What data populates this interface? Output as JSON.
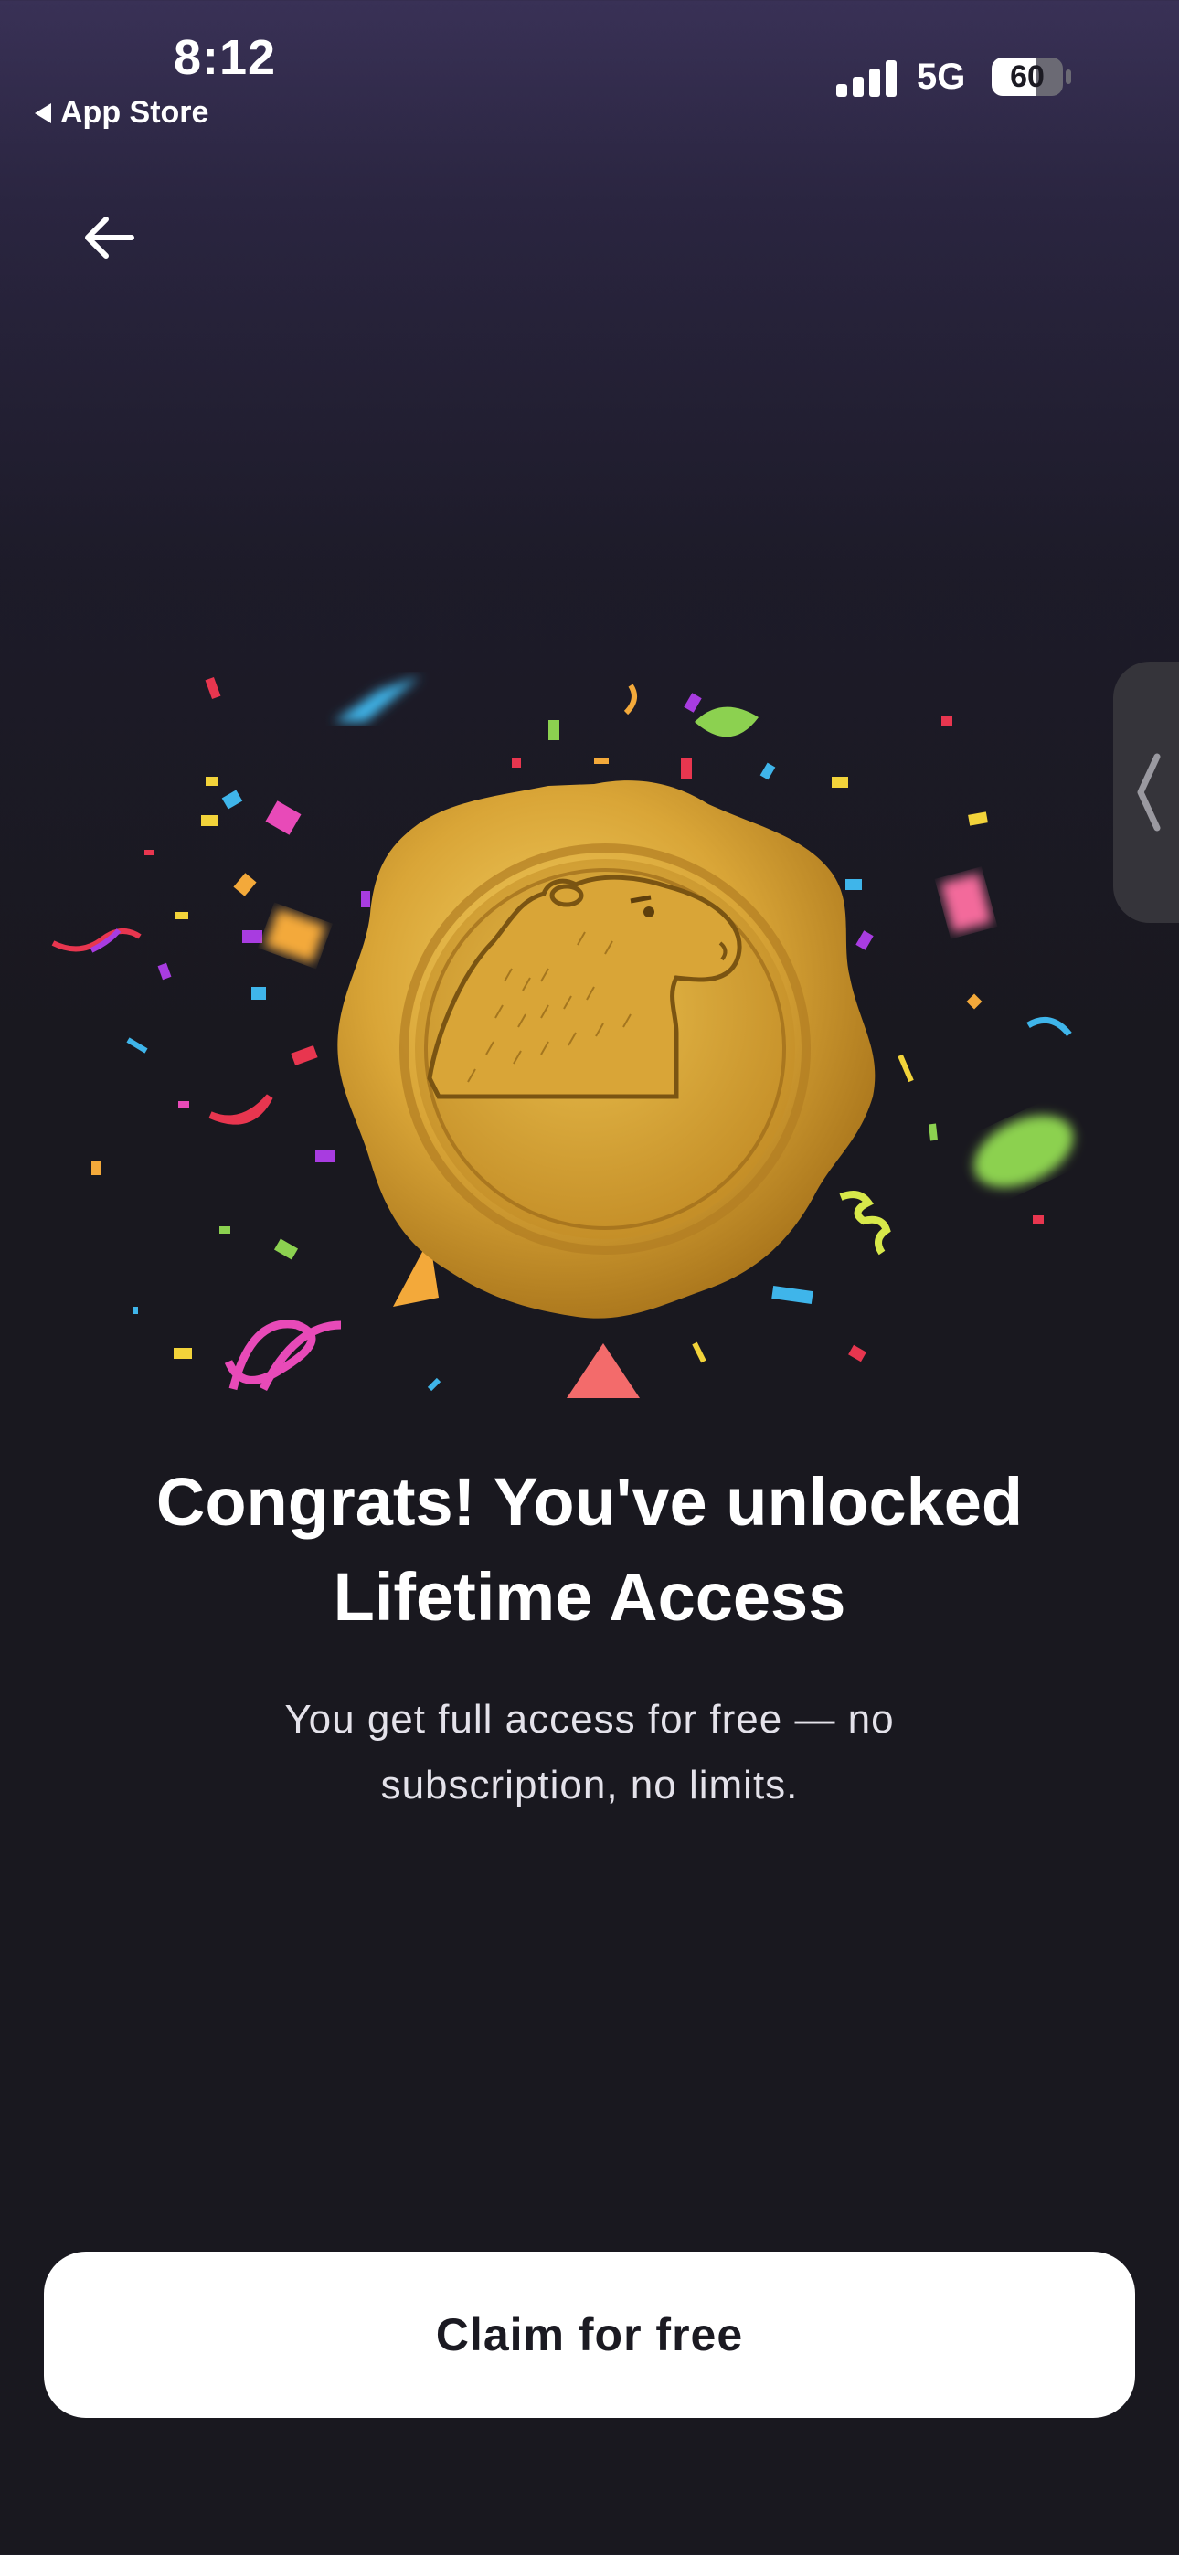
{
  "status_bar": {
    "time": "8:12",
    "back_to_app": "App Store",
    "network": "5G",
    "battery_level": "60"
  },
  "header": {
    "back_icon": "arrow-left-icon"
  },
  "hero": {
    "badge_icon": "capybara-wax-seal-icon",
    "decoration": "confetti"
  },
  "content": {
    "title_line1": "Congrats! You've unlocked",
    "title_line2": "Lifetime Access",
    "subtitle_line1": "You get full access for free — no",
    "subtitle_line2": "subscription, no limits."
  },
  "cta": {
    "label": "Claim for free"
  },
  "colors": {
    "background": "#19181f",
    "gradient_top": "#393156",
    "gold": "#d4a034",
    "button_bg": "#ffffff",
    "button_text": "#1b1a22"
  }
}
